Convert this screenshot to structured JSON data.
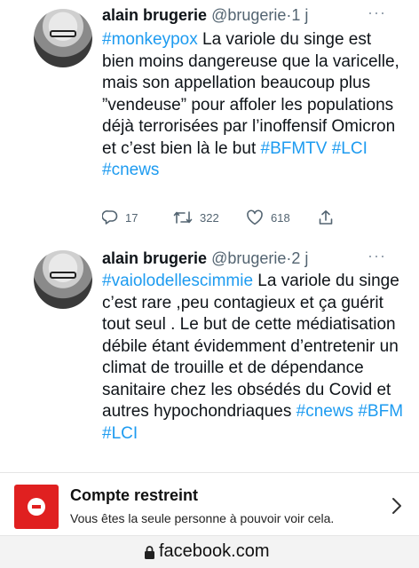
{
  "tweets": [
    {
      "name": "alain brugerie",
      "handle": "@brugerie",
      "dot": "·",
      "time": "1 j",
      "more": "···",
      "body": [
        {
          "text": "#monkeypox",
          "tag": true
        },
        {
          "text": " La variole du singe est bien moins dangereuse que la varicelle, mais son appellation beaucoup plus ”vendeuse” pour affoler les populations déjà terrorisées par l’inoffensif Omicron et c’est bien là le but ",
          "tag": false
        },
        {
          "text": "#BFMTV",
          "tag": true
        },
        {
          "text": " ",
          "tag": false
        },
        {
          "text": "#LCI",
          "tag": true
        },
        {
          "text": " ",
          "tag": false
        },
        {
          "text": "#cnews",
          "tag": true
        }
      ],
      "actions": {
        "replies": "17",
        "retweets": "322",
        "likes": "618"
      }
    },
    {
      "name": "alain brugerie",
      "handle": "@brugerie",
      "dot": "·",
      "time": "2 j",
      "more": "···",
      "body": [
        {
          "text": "#vaiolodellescimmie",
          "tag": true
        },
        {
          "text": " La variole du singe c’est rare ,peu contagieux et ça guérit tout seul . Le but de cette médiatisation débile étant évidemment d’entretenir un climat de trouille et de dépendance sanitaire chez les obsédés du Covid et autres hypochondriaques ",
          "tag": false
        },
        {
          "text": "#cnews",
          "tag": true
        },
        {
          "text": " ",
          "tag": false
        },
        {
          "text": "#BFM",
          "tag": true
        },
        {
          "text": " ",
          "tag": false
        },
        {
          "text": "#LCI",
          "tag": true
        }
      ]
    }
  ],
  "banner": {
    "title": "Compte restreint",
    "subtitle": "Vous êtes la seule personne à pouvoir voir cela."
  },
  "footer": {
    "url": "facebook.com"
  },
  "colors": {
    "hashtag": "#1d9bf0",
    "restricted_badge": "#e02020"
  },
  "icons": [
    "reply-icon",
    "retweet-icon",
    "like-icon",
    "share-icon",
    "restricted-icon",
    "chevron-right-icon",
    "lock-icon"
  ]
}
